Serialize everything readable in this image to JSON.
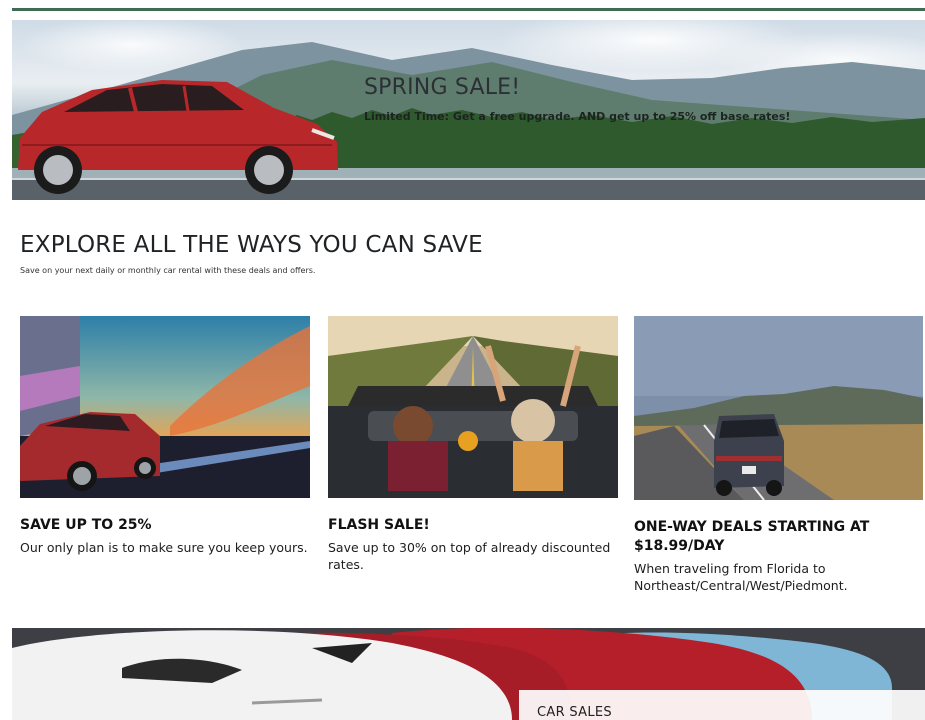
{
  "hero": {
    "title": "SPRING SALE!",
    "subtitle": "Limited Time: Get a free upgrade. AND get up to 25% off base rates!"
  },
  "section": {
    "title": "EXPLORE ALL THE WAYS YOU CAN SAVE",
    "subtitle": "Save on your next daily or monthly car rental with these deals and offers."
  },
  "deals": [
    {
      "title": "SAVE UP TO 25%",
      "text": "Our only plan is to make sure you keep yours."
    },
    {
      "title": "FLASH SALE!",
      "text": "Save up to 30% on top of already discounted rates."
    },
    {
      "title": "ONE-WAY DEALS STARTING AT $18.99/DAY",
      "text": "When traveling from Florida to Northeast/Central/West/Piedmont."
    }
  ],
  "car_sales": {
    "label": "CAR SALES"
  },
  "colors": {
    "accent_rule": "#3f6b55",
    "car_red": "#b8282a"
  }
}
